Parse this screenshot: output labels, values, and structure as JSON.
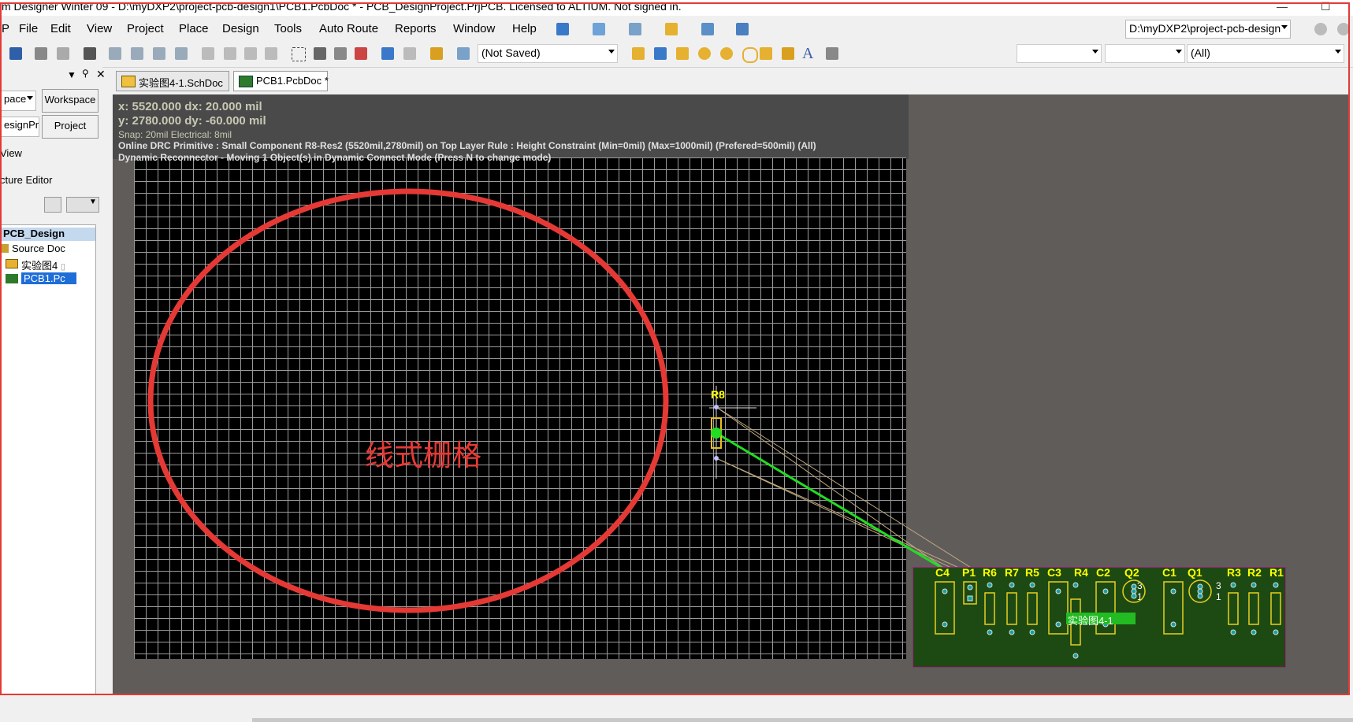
{
  "window": {
    "title": "m Designer Winter 09 - D:\\myDXP2\\project-pcb-design1\\PCB1.PcbDoc * - PCB_DesignProject.PrjPCB. Licensed to ALTIUM. Not signed in."
  },
  "menu": {
    "items": [
      "P",
      "File",
      "Edit",
      "View",
      "Project",
      "Place",
      "Design",
      "Tools",
      "Auto Route",
      "Reports",
      "Window",
      "Help"
    ],
    "path_dropdown": "D:\\myDXP2\\project-pcb-design"
  },
  "toolbar": {
    "saved_state": "(Not Saved)",
    "filter_value": "(All)"
  },
  "left_panel": {
    "workspace_dropdown": "pace",
    "workspace_button": "Workspace",
    "project_field": "esignPr",
    "project_button": "Project",
    "view_label": "View",
    "structure_editor_label": "cture Editor",
    "tree": {
      "root": "PCB_Design",
      "source_docs": "Source Doc",
      "sch_item": "实验图4",
      "pcb_item": "PCB1.Pc"
    }
  },
  "doc_tabs": [
    {
      "label": "实验图4-1.SchDoc"
    },
    {
      "label": "PCB1.PcbDoc *"
    }
  ],
  "canvas": {
    "x_line": "x:  5520.000   dx:    20.000  mil",
    "y_line": "y:  2780.000   dy:   -60.000  mil",
    "snap_line": "Snap: 20mil Electrical: 8mil",
    "drc_line": "Online DRC Primitive : Small Component R8-Res2 (5520mil,2780mil) on Top Layer Rule : Height Constraint (Min=0mil) (Max=1000mil) (Prefered=500mil) (All)",
    "reconnector_line": "Dynamic Reconnector - Moving 1 Object(s) in Dynamic Connect Mode (Press N to change mode)",
    "annotation": "线式栅格",
    "moving_component": "R8",
    "room_label": "实验图4-1",
    "component_labels": [
      "C4",
      "P1",
      "R6",
      "R7",
      "R5",
      "C3",
      "R4",
      "C2",
      "Q2",
      "C1",
      "Q1",
      "R3",
      "R2",
      "R1"
    ],
    "pin_labels": [
      "3",
      "1",
      "3",
      "1"
    ]
  },
  "colors": {
    "annotation_red": "#e53935",
    "grid_black": "#000000",
    "board_green": "#1d4a12",
    "label_yellow": "#ffff00",
    "connection_green": "#22dd22"
  }
}
